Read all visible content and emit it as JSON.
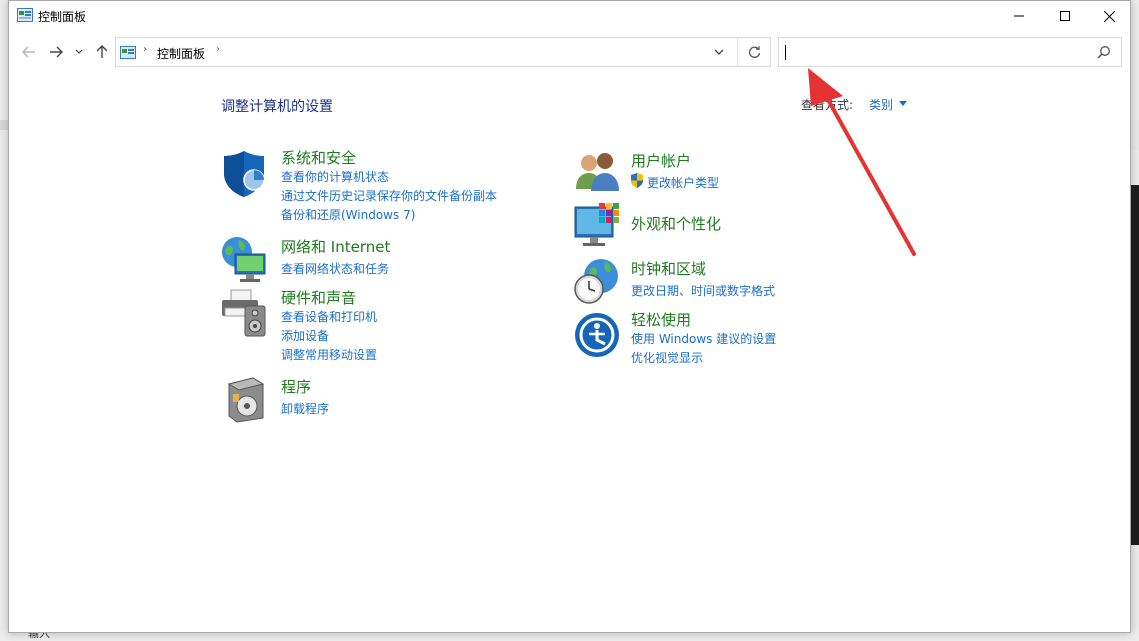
{
  "window": {
    "title": "控制面板",
    "title_icon": "control-panel-icon"
  },
  "address": {
    "crumb": "控制面板",
    "separator": "›"
  },
  "search": {
    "value": "",
    "placeholder": ""
  },
  "content": {
    "heading": "调整计算机的设置",
    "view_by_label": "查看方式:",
    "view_by_value": "类别"
  },
  "categories": {
    "system_security": {
      "title": "系统和安全",
      "icon": "shield-icon",
      "links": [
        "查看你的计算机状态",
        "通过文件历史记录保存你的文件备份副本",
        "备份和还原(Windows 7)"
      ]
    },
    "network": {
      "title": "网络和 Internet",
      "icon": "network-globe-icon",
      "links": [
        "查看网络状态和任务"
      ]
    },
    "hardware": {
      "title": "硬件和声音",
      "icon": "printer-speaker-icon",
      "links": [
        "查看设备和打印机",
        "添加设备",
        "调整常用移动设置"
      ]
    },
    "programs": {
      "title": "程序",
      "icon": "programs-disc-icon",
      "links": [
        "卸载程序"
      ]
    },
    "user_accounts": {
      "title": "用户帐户",
      "icon": "users-icon",
      "links": [
        "更改帐户类型"
      ]
    },
    "appearance": {
      "title": "外观和个性化",
      "icon": "monitor-palette-icon",
      "links": []
    },
    "clock_region": {
      "title": "时钟和区域",
      "icon": "clock-globe-icon",
      "links": [
        "更改日期、时间或数字格式"
      ]
    },
    "ease_of_access": {
      "title": "轻松使用",
      "icon": "ease-of-access-icon",
      "links": [
        "使用 Windows 建议的设置",
        "优化视觉显示"
      ]
    }
  },
  "background": {
    "input_fragment": "输入"
  },
  "colors": {
    "category_title": "#1e7b1e",
    "link": "#1a6fc9",
    "heading": "#1e3287",
    "annotation_arrow": "#e53333"
  }
}
